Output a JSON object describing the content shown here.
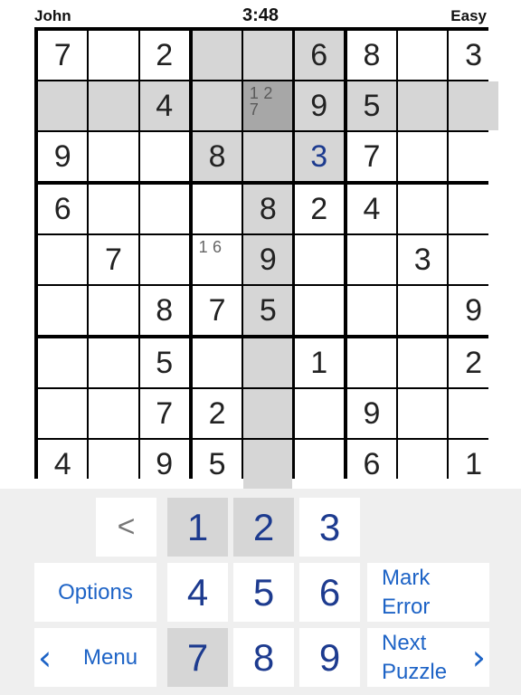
{
  "header": {
    "player": "John",
    "time": "3:48",
    "level": "Easy"
  },
  "board": {
    "cells": [
      [
        "7",
        "",
        "2",
        "",
        "",
        "6",
        "8",
        "",
        "3"
      ],
      [
        "",
        "",
        "4",
        "",
        "",
        "9",
        "5",
        "",
        ""
      ],
      [
        "9",
        "",
        "",
        "8",
        "",
        "3",
        "7",
        "",
        ""
      ],
      [
        "6",
        "",
        "",
        "",
        "8",
        "2",
        "4",
        "",
        ""
      ],
      [
        "",
        "7",
        "",
        "",
        "9",
        "",
        "",
        "3",
        ""
      ],
      [
        "",
        "",
        "8",
        "7",
        "5",
        "",
        "",
        "",
        "9"
      ],
      [
        "",
        "",
        "5",
        "",
        "",
        "1",
        "",
        "",
        "2"
      ],
      [
        "",
        "",
        "7",
        "2",
        "",
        "",
        "9",
        "",
        ""
      ],
      [
        "4",
        "",
        "9",
        "5",
        "",
        "",
        "6",
        "",
        "1"
      ]
    ],
    "selected": [
      1,
      4
    ],
    "user_entered": [
      [
        2,
        5
      ]
    ],
    "notes": [
      {
        "r": 1,
        "c": 4,
        "n": [
          "1",
          "2",
          "",
          "7",
          "",
          "",
          "",
          "",
          ""
        ]
      },
      {
        "r": 4,
        "c": 3,
        "n": [
          "1",
          "6",
          "",
          "",
          "",
          "",
          "",
          "",
          ""
        ]
      }
    ]
  },
  "keypad": {
    "back_label": "<",
    "options_label": "Options",
    "menu_label": "Menu",
    "mark_error_line1": "Mark",
    "mark_error_line2": "Error",
    "next_puzzle_line1": "Next",
    "next_puzzle_line2": "Puzzle",
    "digits": [
      "1",
      "2",
      "3",
      "4",
      "5",
      "6",
      "7",
      "8",
      "9"
    ],
    "active_digits": [
      "1",
      "2",
      "7"
    ]
  }
}
